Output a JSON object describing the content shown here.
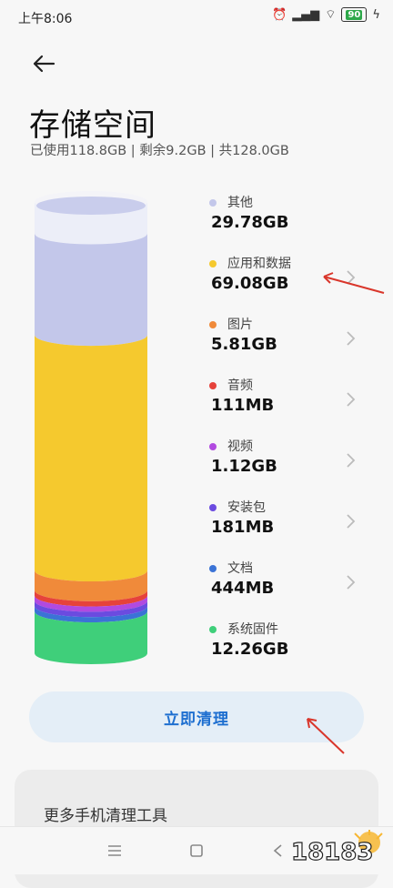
{
  "status_bar": {
    "time": "上午8:06",
    "battery": "90"
  },
  "header": {
    "title": "存储空间",
    "summary": "已使用118.8GB | 剩余9.2GB | 共128.0GB"
  },
  "chart_data": {
    "type": "bar",
    "stacked": true,
    "categories": [
      "其他",
      "应用和数据",
      "图片",
      "音频",
      "视频",
      "安装包",
      "文档",
      "系统固件"
    ],
    "values_gb": [
      29.78,
      69.08,
      5.81,
      0.111,
      1.12,
      0.181,
      0.444,
      12.26
    ],
    "total_gb": 128.0,
    "free_gb": 9.2
  },
  "legend": [
    {
      "name": "其他",
      "size": "29.78GB",
      "color": "#c3c7ea",
      "chevron": false
    },
    {
      "name": "应用和数据",
      "size": "69.08GB",
      "color": "#f5c92e",
      "chevron": true
    },
    {
      "name": "图片",
      "size": "5.81GB",
      "color": "#f08a3a",
      "chevron": true
    },
    {
      "name": "音频",
      "size": "111MB",
      "color": "#e6423b",
      "chevron": true
    },
    {
      "name": "视频",
      "size": "1.12GB",
      "color": "#b14ae0",
      "chevron": true
    },
    {
      "name": "安装包",
      "size": "181MB",
      "color": "#6b4be0",
      "chevron": true
    },
    {
      "name": "文档",
      "size": "444MB",
      "color": "#3b73d6",
      "chevron": true
    },
    {
      "name": "系统固件",
      "size": "12.26GB",
      "color": "#3fcf7a",
      "chevron": false
    }
  ],
  "actions": {
    "clean_now": "立即清理"
  },
  "tools": {
    "title": "更多手机清理工具"
  },
  "watermark": {
    "text": "18183"
  },
  "colors": {
    "accent": "#1e6fd0",
    "annotation": "#d9362b"
  }
}
